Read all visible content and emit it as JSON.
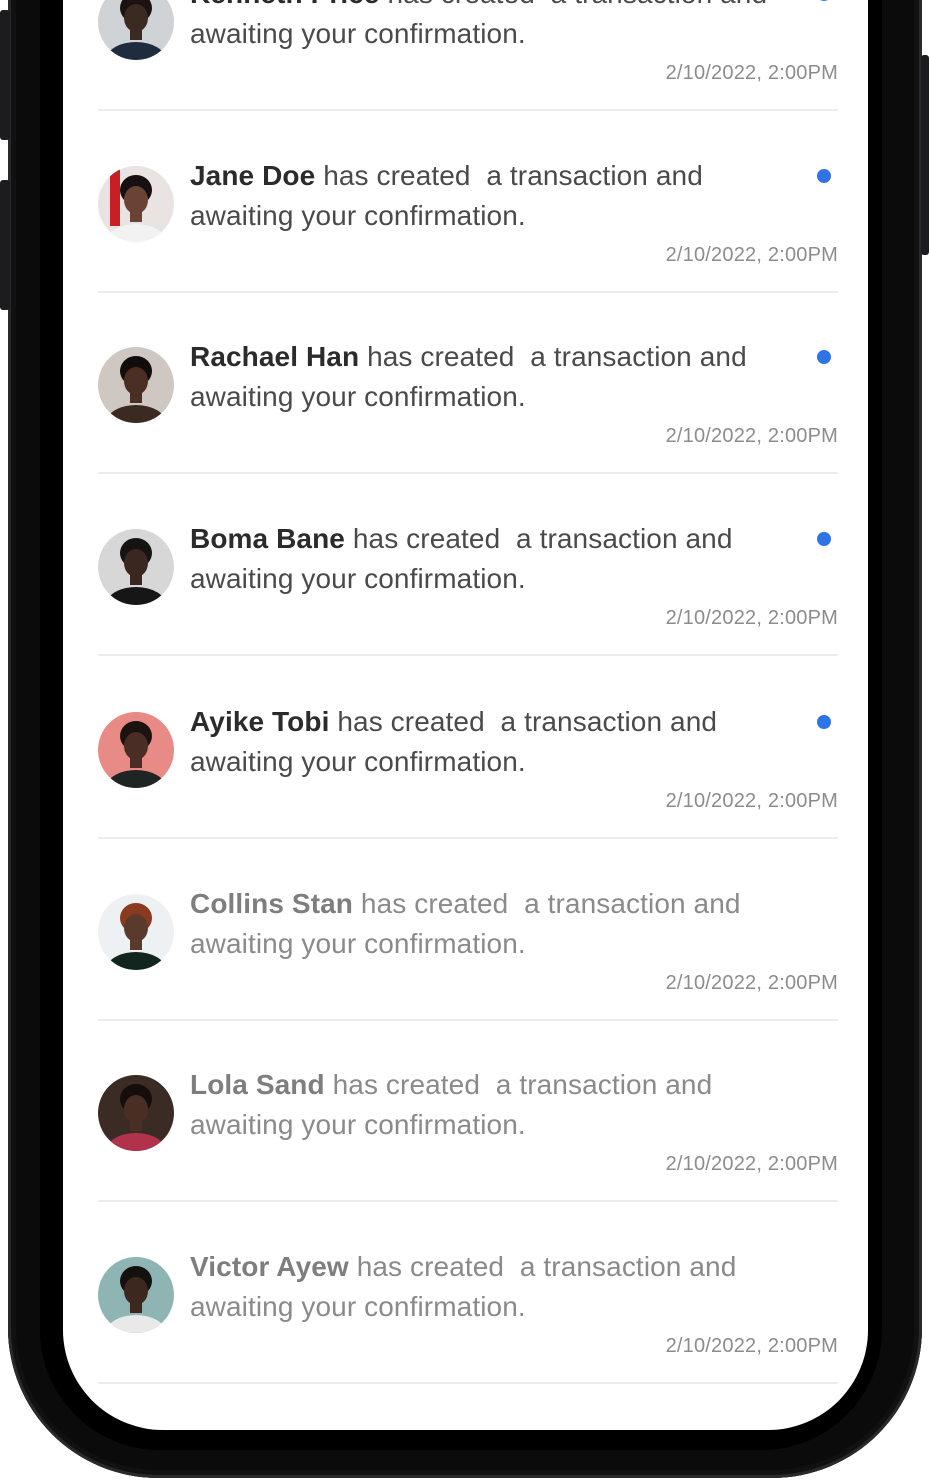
{
  "colors": {
    "unread_dot": "#2f74e6",
    "divider": "#ececec",
    "text_unread": "#4a4a4a",
    "text_read": "#8a8a8a"
  },
  "notifications": [
    {
      "name": "Kenneth Price",
      "action": "has created  a transaction and",
      "line2": "awaiting your confirmation.",
      "time": "2/10/2022, 2:00PM",
      "unread": true,
      "avatar_icon": "user-avatar"
    },
    {
      "name": "Jane Doe",
      "action": "has created  a transaction and",
      "line2": "awaiting your confirmation.",
      "time": "2/10/2022, 2:00PM",
      "unread": true,
      "avatar_icon": "user-avatar"
    },
    {
      "name": "Rachael Han",
      "action": "has created  a transaction and",
      "line2": "awaiting your confirmation.",
      "time": "2/10/2022, 2:00PM",
      "unread": true,
      "avatar_icon": "user-avatar"
    },
    {
      "name": "Boma Bane",
      "action": "has created  a transaction and",
      "line2": "awaiting your confirmation.",
      "time": "2/10/2022, 2:00PM",
      "unread": true,
      "avatar_icon": "user-avatar"
    },
    {
      "name": "Ayike Tobi",
      "action": "has created  a transaction and",
      "line2": "awaiting your confirmation.",
      "time": "2/10/2022, 2:00PM",
      "unread": true,
      "avatar_icon": "user-avatar"
    },
    {
      "name": "Collins Stan",
      "action": "has created  a transaction and",
      "line2": "awaiting your confirmation.",
      "time": "2/10/2022, 2:00PM",
      "unread": false,
      "avatar_icon": "user-avatar"
    },
    {
      "name": "Lola Sand",
      "action": "has created  a transaction and",
      "line2": "awaiting your confirmation.",
      "time": "2/10/2022, 2:00PM",
      "unread": false,
      "avatar_icon": "user-avatar"
    },
    {
      "name": "Victor Ayew",
      "action": "has created  a transaction and",
      "line2": "awaiting your confirmation.",
      "time": "2/10/2022, 2:00PM",
      "unread": false,
      "avatar_icon": "user-avatar"
    }
  ]
}
